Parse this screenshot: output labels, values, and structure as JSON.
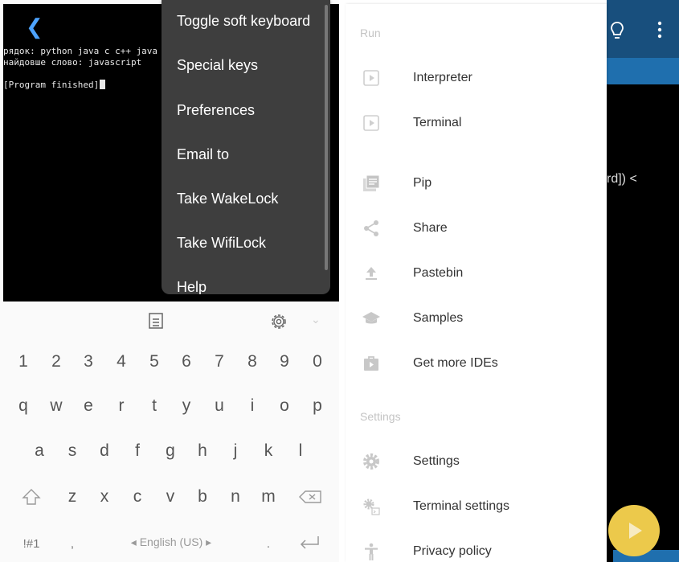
{
  "terminal": {
    "back_icon": "chevron-left-icon",
    "lines": [
      "рядок: python java c c++ java",
      "найдовше слово: javascript",
      "",
      "[Program finished]"
    ]
  },
  "context_menu": {
    "items": [
      "Toggle soft keyboard",
      "Special keys",
      "Preferences",
      "Email to",
      "Take WakeLock",
      "Take WifiLock",
      "Help"
    ]
  },
  "keyboard": {
    "toolbar": {
      "clipboard_icon": "clipboard-icon",
      "settings_icon": "gear-icon",
      "collapse_icon": "chevron-down-icon"
    },
    "row_numbers": [
      "1",
      "2",
      "3",
      "4",
      "5",
      "6",
      "7",
      "8",
      "9",
      "0"
    ],
    "row_q": [
      "q",
      "w",
      "e",
      "r",
      "t",
      "y",
      "u",
      "i",
      "o",
      "p"
    ],
    "row_a": [
      "a",
      "s",
      "d",
      "f",
      "g",
      "h",
      "j",
      "k",
      "l"
    ],
    "row_z": [
      "z",
      "x",
      "c",
      "v",
      "b",
      "n",
      "m"
    ],
    "shift_icon": "shift-icon",
    "backspace_icon": "backspace-icon",
    "symbols_label": "!#1",
    "comma_label": ",",
    "language_label": "◂ English (US) ▸",
    "period_label": ".",
    "enter_icon": "enter-icon"
  },
  "drawer": {
    "section_run": "Run",
    "section_settings": "Settings",
    "items": [
      {
        "label": "Interpreter",
        "icon": "play-box-icon"
      },
      {
        "label": "Terminal",
        "icon": "play-box-icon"
      },
      {
        "label": "Pip",
        "icon": "library-icon"
      },
      {
        "label": "Share",
        "icon": "share-icon"
      },
      {
        "label": "Pastebin",
        "icon": "upload-icon"
      },
      {
        "label": "Samples",
        "icon": "school-icon"
      },
      {
        "label": "Get more IDEs",
        "icon": "store-icon"
      },
      {
        "label": "Settings",
        "icon": "gear-icon"
      },
      {
        "label": "Terminal settings",
        "icon": "terminal-settings-icon"
      },
      {
        "label": "Privacy policy",
        "icon": "accessibility-icon"
      }
    ]
  },
  "editor_behind": {
    "code_fragment": "rd]) <",
    "appbar_color": "#1f6fae",
    "fab_color": "#ecc94b",
    "bulb_icon": "lightbulb-icon",
    "more_icon": "more-vert-icon",
    "run_icon": "play-icon"
  }
}
